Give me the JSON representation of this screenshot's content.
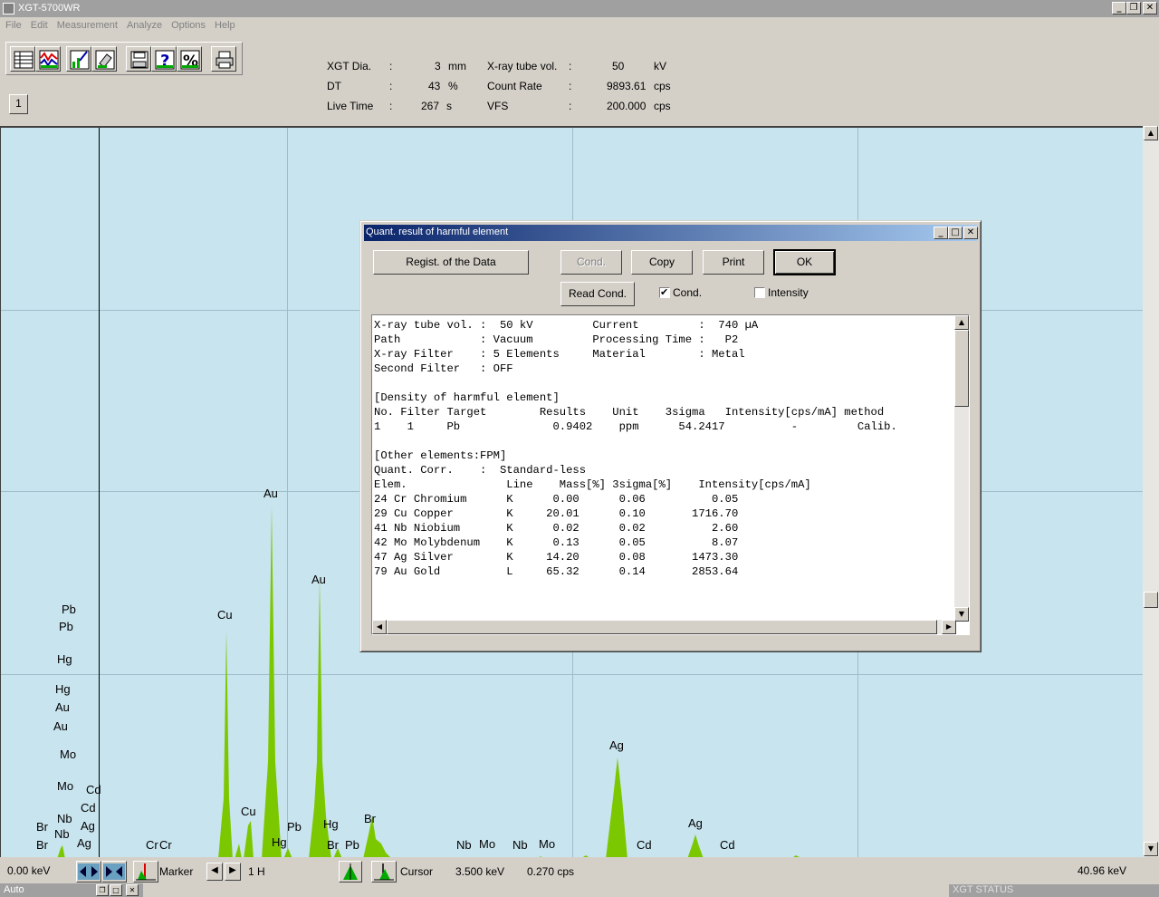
{
  "window": {
    "title": "XGT-5700WR"
  },
  "menu": [
    "File",
    "Edit",
    "Measurement",
    "Analyze",
    "Options",
    "Help"
  ],
  "toolbar": {
    "icons": [
      "table-icon",
      "spectrum-compare-icon",
      "chart-edit-icon",
      "eraser-icon",
      "save-icon",
      "help-icon",
      "percent-icon",
      "print-icon"
    ],
    "page_button": "1"
  },
  "info": {
    "xgt_dia_label": "XGT Dia.",
    "xgt_dia_value": "3",
    "xgt_dia_unit": "mm",
    "dt_label": "DT",
    "dt_value": "43",
    "dt_unit": "%",
    "live_time_label": "Live Time",
    "live_time_value": "267",
    "live_time_unit": "s",
    "tube_vol_label": "X-ray tube vol.",
    "tube_vol_value": "50",
    "tube_vol_unit": "kV",
    "count_rate_label": "Count Rate",
    "count_rate_value": "9893.61",
    "count_rate_unit": "cps",
    "vfs_label": "VFS",
    "vfs_value": "200.000",
    "vfs_unit": "cps",
    "colon": ":"
  },
  "spectrum": {
    "fill_color": "#7cc800",
    "background_color": "#c8e4ee",
    "labels": [
      "Au",
      "Au",
      "Cu",
      "Cu",
      "Pb",
      "Pb",
      "Pb",
      "Hg",
      "Hg",
      "Hg",
      "Au",
      "Au",
      "Mo",
      "Mo",
      "Cd",
      "Cd",
      "Ag",
      "Ag",
      "Nb",
      "Nb",
      "Br",
      "Br",
      "Br",
      "Br",
      "Pb",
      "Hg",
      "Cr",
      "Cr",
      "Nb",
      "Mo",
      "Nb",
      "Mo",
      "Ag",
      "Ag",
      "Cd",
      "Cd"
    ]
  },
  "statusbar": {
    "start_kev": "0.00 keV",
    "marker_label": "Marker",
    "marker_value": "1 H",
    "cursor_label": "Cursor",
    "cursor_kev": "3.500 keV",
    "cursor_cps": "0.270 cps",
    "end_kev": "40.96 keV",
    "mode": "Auto",
    "xgt_status": "XGT STATUS"
  },
  "dialog": {
    "title": "Quant. result of harmful element",
    "regist_button": "Regist. of the Data",
    "cond_button": "Cond.",
    "copy_button": "Copy",
    "print_button": "Print",
    "ok_button": "OK",
    "read_cond_button": "Read Cond.",
    "cond_checkbox": "Cond.",
    "cond_checked": true,
    "intensity_checkbox": "Intensity",
    "intensity_checked": false,
    "report_lines": [
      "X-ray tube vol. :  50 kV         Current         :  740 µA",
      "Path            : Vacuum         Processing Time :   P2",
      "X-ray Filter    : 5 Elements     Material        : Metal",
      "Second Filter   : OFF",
      "",
      "[Density of harmful element]",
      "No. Filter Target        Results    Unit    3sigma   Intensity[cps/mA] method",
      "1    1     Pb              0.9402    ppm      54.2417          -         Calib.",
      "",
      "[Other elements:FPM]",
      "Quant. Corr.    :  Standard-less",
      "Elem.               Line    Mass[%] 3sigma[%]    Intensity[cps/mA]",
      "24 Cr Chromium      K      0.00      0.06          0.05",
      "29 Cu Copper        K     20.01      0.10       1716.70",
      "41 Nb Niobium       K      0.02      0.02          2.60",
      "42 Mo Molybdenum    K      0.13      0.05          8.07",
      "47 Ag Silver        K     14.20      0.08       1473.30",
      "79 Au Gold          L     65.32      0.14       2853.64"
    ]
  }
}
